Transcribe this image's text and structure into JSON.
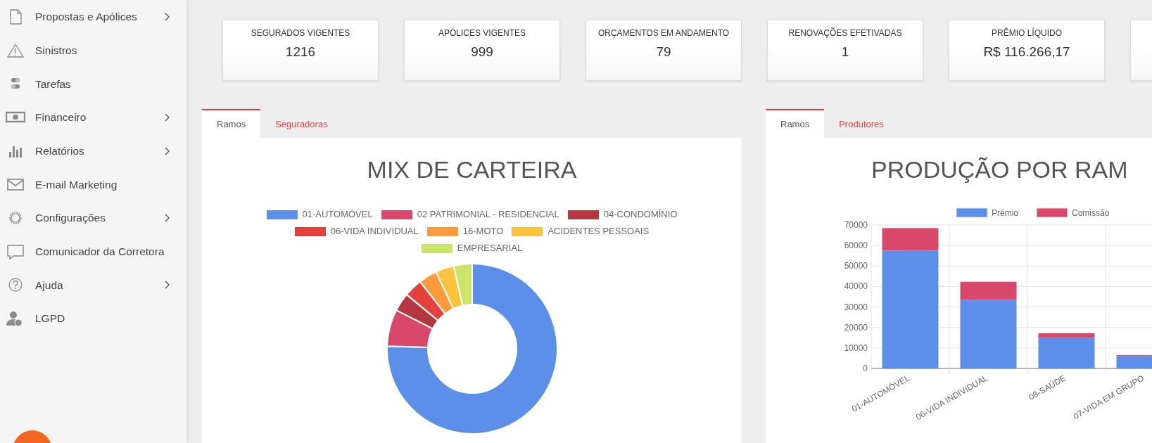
{
  "sidebar": {
    "items": [
      {
        "label": "Propostas e Apólices",
        "has_submenu": true
      },
      {
        "label": "Sinistros",
        "has_submenu": false
      },
      {
        "label": "Tarefas",
        "has_submenu": false
      },
      {
        "label": "Financeiro",
        "has_submenu": true
      },
      {
        "label": "Relatórios",
        "has_submenu": true
      },
      {
        "label": "E-mail Marketing",
        "has_submenu": false
      },
      {
        "label": "Configurações",
        "has_submenu": true
      },
      {
        "label": "Comunicador da Corretora",
        "has_submenu": false
      },
      {
        "label": "Ajuda",
        "has_submenu": true
      },
      {
        "label": "LGPD",
        "has_submenu": false
      }
    ]
  },
  "kpi_cards": [
    {
      "title": "SEGURADOS VIGENTES",
      "value": "1216"
    },
    {
      "title": "APÓLICES VIGENTES",
      "value": "999"
    },
    {
      "title": "ORÇAMENTOS EM ANDAMENTO",
      "value": "79"
    },
    {
      "title": "RENOVAÇÕES EFETIVADAS",
      "value": "1"
    },
    {
      "title": "PRÊMIO LÍQUIDO",
      "value": "R$ 116.266,17"
    }
  ],
  "mix_panel": {
    "tabs": [
      {
        "label": "Ramos",
        "selected": true
      },
      {
        "label": "Seguradoras",
        "selected": false
      }
    ],
    "title": "MIX DE CARTEIRA",
    "legend": [
      {
        "label": "01-AUTOMÓVEL",
        "color": "#5b8fea"
      },
      {
        "label": "02 PATRIMONIAL - RESIDENCIAL",
        "color": "#d9486b"
      },
      {
        "label": "04-CONDOMÍNIO",
        "color": "#b5373f"
      },
      {
        "label": "06-VIDA INDIVIDUAL",
        "color": "#e5413b"
      },
      {
        "label": "16-MOTO",
        "color": "#fd9a3c"
      },
      {
        "label": "ACIDENTES PESSOAIS",
        "color": "#fdc23e"
      },
      {
        "label": "EMPRESARIAL",
        "color": "#cde46a"
      }
    ]
  },
  "production_panel": {
    "tabs": [
      {
        "label": "Ramos",
        "selected": true
      },
      {
        "label": "Produtores",
        "selected": false
      }
    ],
    "title": "PRODUÇÃO POR RAM",
    "chart_data": {
      "type": "bar",
      "stacked": true,
      "categories": [
        "01-AUTOMÓVEL",
        "06-VIDA INDIVIDUAL",
        "08-SAÚDE",
        "07-VIDA EM GRUPO"
      ],
      "series": [
        {
          "name": "Prêmio",
          "color": "#5b8fea",
          "values": [
            57500,
            33500,
            15000,
            6000
          ]
        },
        {
          "name": "Comissão",
          "color": "#d9486b",
          "values": [
            11000,
            8800,
            2200,
            500
          ]
        }
      ],
      "grid": true,
      "legend": true,
      "ylim": [
        0,
        70000
      ],
      "yticks": [
        0,
        10000,
        20000,
        30000,
        40000,
        50000,
        60000,
        70000
      ]
    }
  }
}
